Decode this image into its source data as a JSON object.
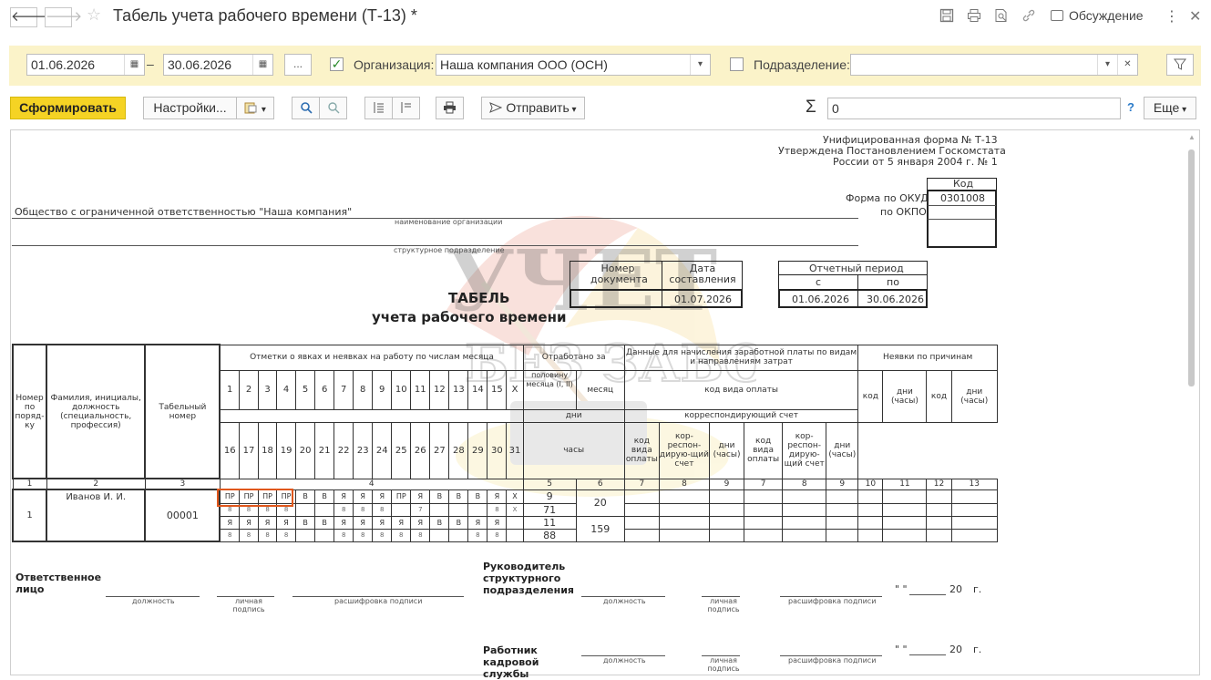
{
  "window": {
    "title": "Табель учета рабочего времени (Т-13) *",
    "discussion_label": "Обсуждение"
  },
  "filters": {
    "date_from": "01.06.2026",
    "date_dash": "–",
    "date_to": "30.06.2026",
    "period_button": "...",
    "organization_checked": true,
    "organization_label": "Организация:",
    "organization_value": "Наша компания ООО (ОСН)",
    "subdivision_checked": false,
    "subdivision_label": "Подразделение:",
    "subdivision_value": ""
  },
  "toolbar": {
    "generate_label": "Сформировать",
    "settings_label": "Настройки...",
    "send_label": "Отправить",
    "sum_value": "0",
    "help_label": "?",
    "more_label": "Еще"
  },
  "report": {
    "form_header": [
      "Унифицированная форма № Т-13",
      "Утверждена Постановлением Госкомстата",
      "России от 5 января 2004 г. № 1"
    ],
    "code_label": "Код",
    "okud_label": "Форма по ОКУД",
    "okud_value": "0301008",
    "okpo_label": "по ОКПО",
    "organization_name": "Общество с ограниченной ответственностью \"Наша компания\"",
    "org_caption": "наименование организации",
    "subdivision_caption": "структурное подразделение",
    "doc_number_label": "Номер документа",
    "doc_date_label": "Дата составления",
    "doc_date_value": "01.07.2026",
    "period_label": "Отчетный период",
    "period_from_label": "с",
    "period_to_label": "по",
    "period_from": "01.06.2026",
    "period_to": "30.06.2026",
    "title_line1": "ТАБЕЛЬ",
    "title_line2": "учета  рабочего времени",
    "table": {
      "h_num": "Номер по поряд-ку",
      "h_name": "Фамилия, инициалы, должность (специальность, профессия)",
      "h_tab": "Табельный номер",
      "h_marks": "Отметки о явках и неявках на работу по числам месяца",
      "h_worked": "Отработано за",
      "h_half": "половину месяца (I, II)",
      "h_month": "месяц",
      "h_days": "дни",
      "h_hours": "часы",
      "h_salary": "Данные для начисления заработной платы по видам и направлениям затрат",
      "h_paycode": "код вида оплаты",
      "h_account": "корреспондирующий счет",
      "h_code_pay": "код вида оплаты",
      "h_corr": "кор-респон-дирую-щий счет",
      "h_dayshours": "дни (часы)",
      "h_absence": "Неявки по причинам",
      "h_code": "код",
      "days_row1": [
        "1",
        "2",
        "3",
        "4",
        "5",
        "6",
        "7",
        "8",
        "9",
        "10",
        "11",
        "12",
        "13",
        "14",
        "15",
        "X"
      ],
      "days_row2": [
        "16",
        "17",
        "18",
        "19",
        "20",
        "21",
        "22",
        "23",
        "24",
        "25",
        "26",
        "27",
        "28",
        "29",
        "30",
        "31"
      ],
      "colnums": [
        "1",
        "2",
        "3",
        "4",
        "5",
        "6",
        "7",
        "8",
        "9",
        "7",
        "8",
        "9",
        "10",
        "11",
        "12",
        "13"
      ],
      "employee": {
        "num": "1",
        "name": "Иванов И. И.",
        "tab_number": "00001",
        "marks1": [
          "ПР",
          "ПР",
          "ПР",
          "ПР",
          "В",
          "В",
          "Я",
          "Я",
          "Я",
          "ПР",
          "Я",
          "В",
          "В",
          "В",
          "Я",
          "X"
        ],
        "hours1": [
          "8",
          "8",
          "8",
          "8",
          "",
          "",
          "8",
          "8",
          "8",
          "",
          "7",
          "",
          "",
          "",
          "8",
          "X"
        ],
        "marks2": [
          "Я",
          "Я",
          "Я",
          "Я",
          "В",
          "В",
          "Я",
          "Я",
          "Я",
          "Я",
          "Я",
          "В",
          "В",
          "Я",
          "Я",
          ""
        ],
        "hours2": [
          "8",
          "8",
          "8",
          "8",
          "",
          "",
          "8",
          "8",
          "8",
          "8",
          "8",
          "",
          "",
          "8",
          "8",
          ""
        ],
        "half1_days": "9",
        "half1_hours": "71",
        "half2_days": "11",
        "half2_hours": "88",
        "month_days": "20",
        "month_hours": "159"
      }
    },
    "sign1_title": "Ответственное лицо",
    "sign2_title": "Руководитель структурного подразделения",
    "sign3_title": "Работник кадровой службы",
    "cap_position": "должность",
    "cap_signature": "личная подпись",
    "cap_decode": "расшифровка подписи",
    "date_prefix": "\" \"",
    "date_year": "20",
    "date_suffix": "г."
  }
}
